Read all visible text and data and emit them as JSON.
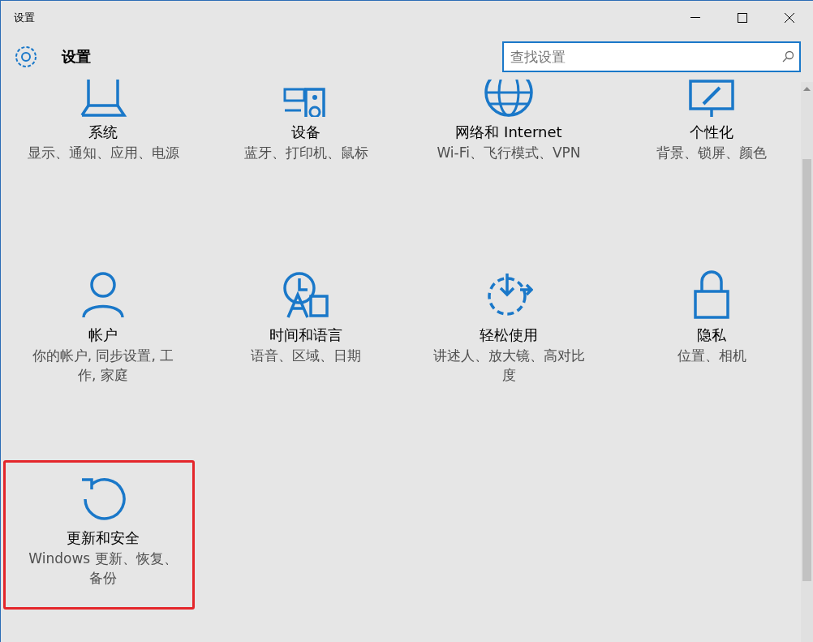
{
  "window": {
    "title": "设置"
  },
  "header": {
    "title": "设置"
  },
  "search": {
    "placeholder": "查找设置"
  },
  "tiles": [
    {
      "title": "系统",
      "description": "显示、通知、应用、电源",
      "highlighted": false
    },
    {
      "title": "设备",
      "description": "蓝牙、打印机、鼠标",
      "highlighted": false
    },
    {
      "title": "网络和 Internet",
      "description": "Wi-Fi、飞行模式、VPN",
      "highlighted": false
    },
    {
      "title": "个性化",
      "description": "背景、锁屏、颜色",
      "highlighted": false
    },
    {
      "title": "帐户",
      "description": "你的帐户, 同步设置, 工作, 家庭",
      "highlighted": false
    },
    {
      "title": "时间和语言",
      "description": "语音、区域、日期",
      "highlighted": false
    },
    {
      "title": "轻松使用",
      "description": "讲述人、放大镜、高对比度",
      "highlighted": false
    },
    {
      "title": "隐私",
      "description": "位置、相机",
      "highlighted": false
    },
    {
      "title": "更新和安全",
      "description": "Windows 更新、恢复、备份",
      "highlighted": true
    }
  ]
}
